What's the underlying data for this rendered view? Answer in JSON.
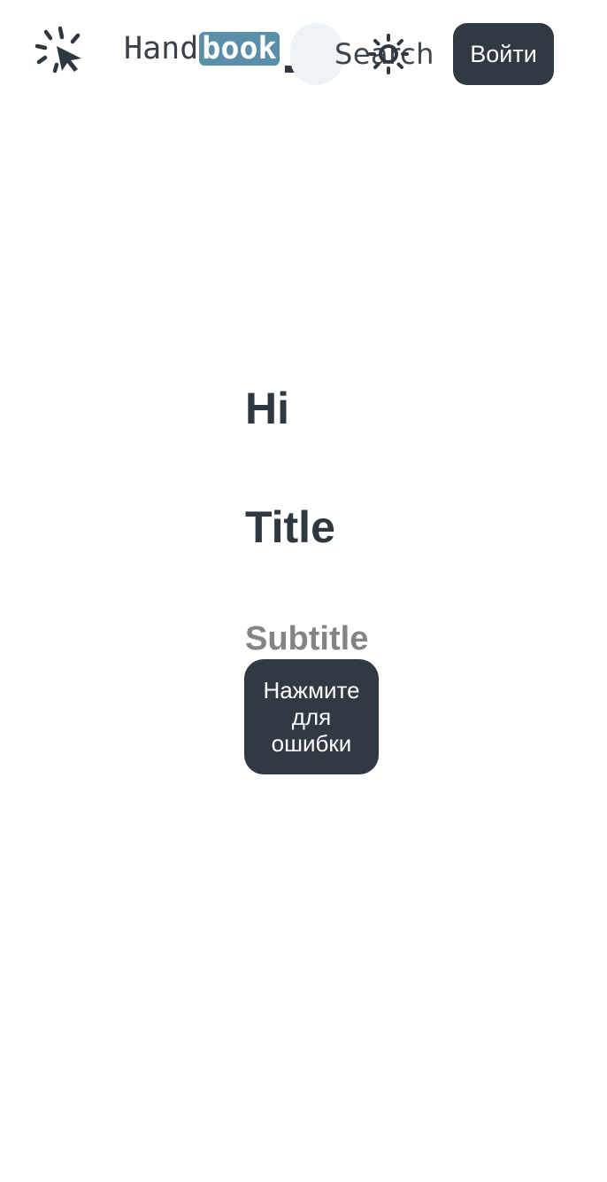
{
  "header": {
    "logo_icon": "click-pointer-icon",
    "brand_plain": "Hand",
    "brand_highlight": "book",
    "search_label": "Search",
    "theme_icon": "sun-icon",
    "login_label": "Войти"
  },
  "main": {
    "greeting": "Hi",
    "title": "Title",
    "subtitle": "Subtitle",
    "error_button_label": "Нажмите для ошибки"
  },
  "colors": {
    "primary_dark": "#313a42",
    "brand_accent": "#5b8ea8",
    "subtitle_gray": "#838486",
    "search_bubble": "#eef3f7"
  }
}
